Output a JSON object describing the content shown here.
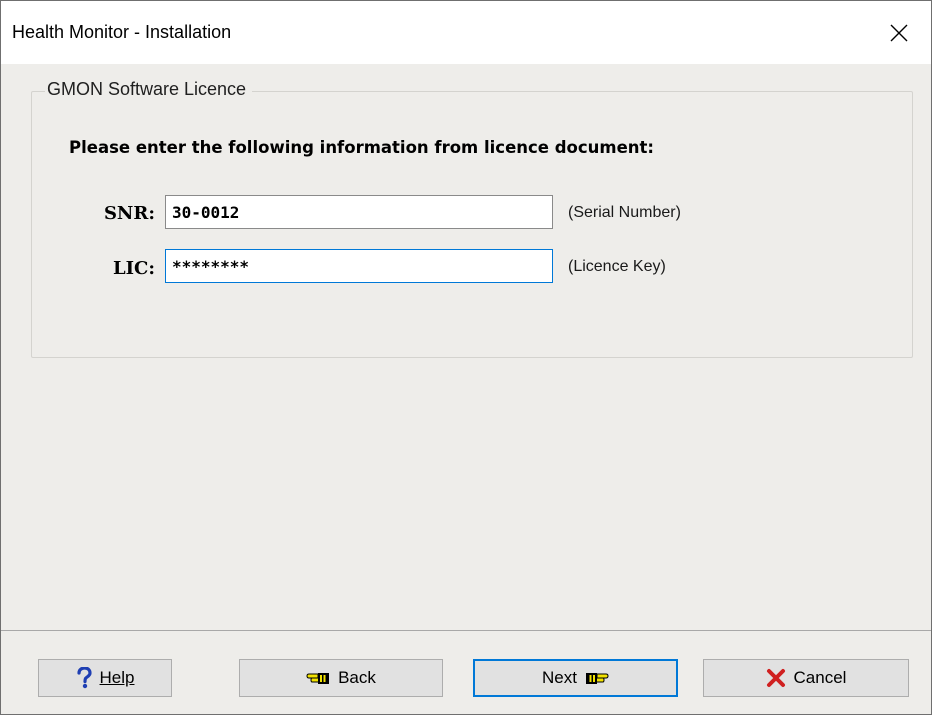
{
  "window": {
    "title": "Health Monitor - Installation",
    "close_icon": "close-icon"
  },
  "groupbox": {
    "legend": "GMON Software Licence",
    "instruction": "Please enter the following information from licence document:"
  },
  "fields": {
    "snr": {
      "label": "SNR:",
      "value": "30-0012",
      "hint": "(Serial Number)"
    },
    "lic": {
      "label": "LIC:",
      "value": "********",
      "hint": "(Licence Key)"
    }
  },
  "buttons": {
    "help": {
      "label": "Help",
      "icon": "question-icon"
    },
    "back": {
      "label": "Back",
      "icon": "pointing-hand-left-icon"
    },
    "next": {
      "label": "Next",
      "icon": "pointing-hand-right-icon"
    },
    "cancel": {
      "label": "Cancel",
      "icon": "red-x-icon"
    }
  },
  "colors": {
    "client_bg": "#eeedea",
    "focus_border": "#0078d7",
    "help_icon": "#1f3fb3",
    "cancel_icon": "#d02020"
  }
}
